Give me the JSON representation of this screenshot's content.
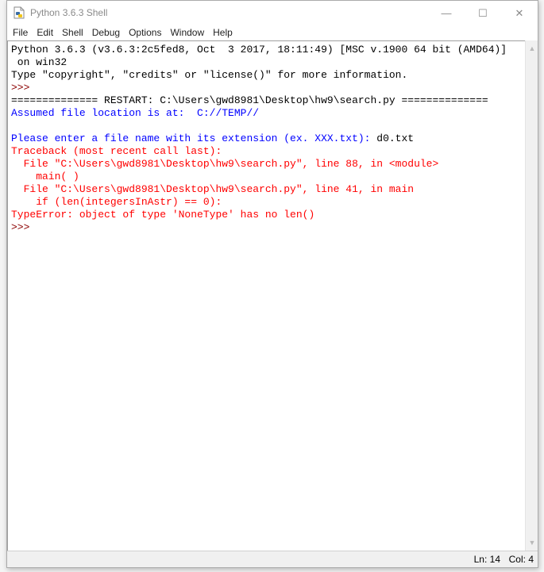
{
  "window": {
    "title": "Python 3.6.3 Shell",
    "controls": {
      "minimize_icon": "—",
      "maximize_icon": "☐",
      "close_icon": "✕"
    }
  },
  "menubar": {
    "items": [
      {
        "label": "File"
      },
      {
        "label": "Edit"
      },
      {
        "label": "Shell"
      },
      {
        "label": "Debug"
      },
      {
        "label": "Options"
      },
      {
        "label": "Window"
      },
      {
        "label": "Help"
      }
    ]
  },
  "shell": {
    "lines": [
      {
        "text": "Python 3.6.3 (v3.6.3:2c5fed8, Oct  3 2017, 18:11:49) [MSC v.1900 64 bit (AMD64)]",
        "style": "black"
      },
      {
        "text": " on win32",
        "style": "black"
      },
      {
        "text": "Type \"copyright\", \"credits\" or \"license()\" for more information.",
        "style": "black"
      },
      {
        "text": ">>> ",
        "style": "prompt"
      },
      {
        "text": "============== RESTART: C:\\Users\\gwd8981\\Desktop\\hw9\\search.py ==============",
        "style": "black"
      },
      {
        "text": "Assumed file location is at:  C://TEMP//",
        "style": "blue"
      },
      {
        "text": "",
        "style": "blue"
      },
      {
        "text": "Please enter a file name with its extension (ex. XXX.txt): ",
        "style": "blue",
        "input": "d0.txt"
      },
      {
        "text": "Traceback (most recent call last):",
        "style": "red"
      },
      {
        "text": "  File \"C:\\Users\\gwd8981\\Desktop\\hw9\\search.py\", line 88, in <module>",
        "style": "red"
      },
      {
        "text": "    main( )",
        "style": "red"
      },
      {
        "text": "  File \"C:\\Users\\gwd8981\\Desktop\\hw9\\search.py\", line 41, in main",
        "style": "red"
      },
      {
        "text": "    if (len(integersInAstr) == 0):",
        "style": "red"
      },
      {
        "text": "TypeError: object of type 'NoneType' has no len()",
        "style": "red"
      },
      {
        "text": ">>> ",
        "style": "prompt"
      }
    ]
  },
  "scrollbar": {
    "up_icon": "▲",
    "down_icon": "▼"
  },
  "statusbar": {
    "line": "Ln: 14",
    "col": "Col: 4"
  },
  "colors": {
    "stdout": "#0000ff",
    "stderr": "#ff0000",
    "prompt": "#8b0000",
    "normal": "#000000"
  }
}
